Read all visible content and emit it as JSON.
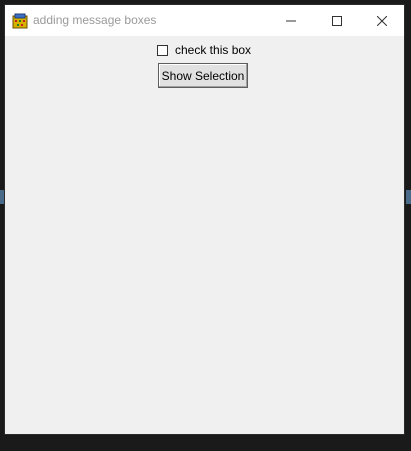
{
  "window": {
    "title": "adding message boxes",
    "app_icon": "feather-icon",
    "controls": {
      "minimize_icon": "minimize-icon",
      "maximize_icon": "maximize-icon",
      "close_icon": "close-icon"
    }
  },
  "content": {
    "checkbox": {
      "label": "check this box",
      "checked": false
    },
    "button": {
      "label": "Show Selection"
    }
  },
  "colors": {
    "client_bg": "#f0f0f0",
    "titlebar_bg": "#ffffff",
    "title_text": "#9a9a9a"
  }
}
